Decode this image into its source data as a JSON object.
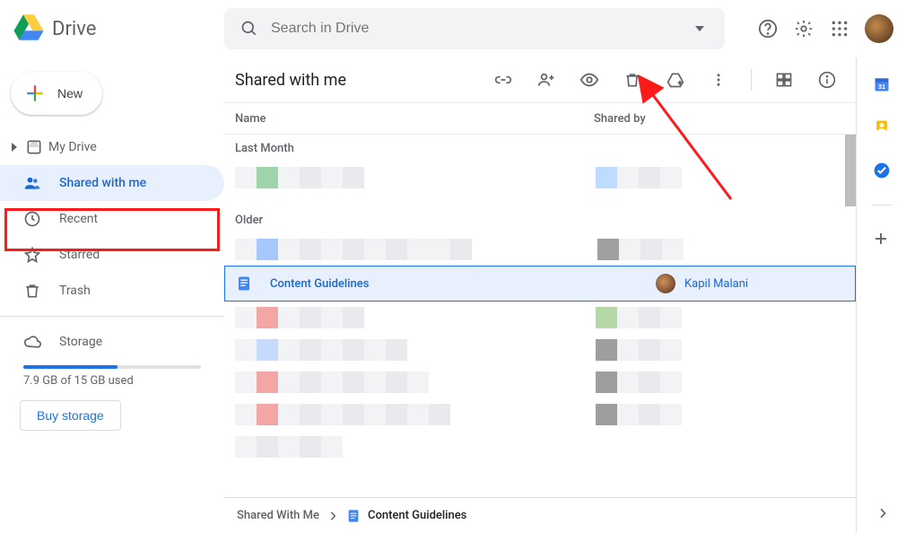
{
  "app": {
    "name": "Drive"
  },
  "search": {
    "placeholder": "Search in Drive"
  },
  "new_button": {
    "label": "New"
  },
  "sidebar": {
    "items": [
      {
        "label": "My Drive"
      },
      {
        "label": "Shared with me"
      },
      {
        "label": "Recent"
      },
      {
        "label": "Starred"
      },
      {
        "label": "Trash"
      },
      {
        "label": "Storage"
      }
    ],
    "storage_used_text": "7.9 GB of 15 GB used",
    "buy_label": "Buy storage"
  },
  "view": {
    "title": "Shared with me"
  },
  "columns": {
    "name": "Name",
    "shared_by": "Shared by"
  },
  "sections": {
    "last_month": "Last Month",
    "older": "Older"
  },
  "selected_file": {
    "name": "Content Guidelines",
    "shared_by": "Kapil Malani"
  },
  "breadcrumb": {
    "root": "Shared With Me",
    "current": "Content Guidelines"
  }
}
